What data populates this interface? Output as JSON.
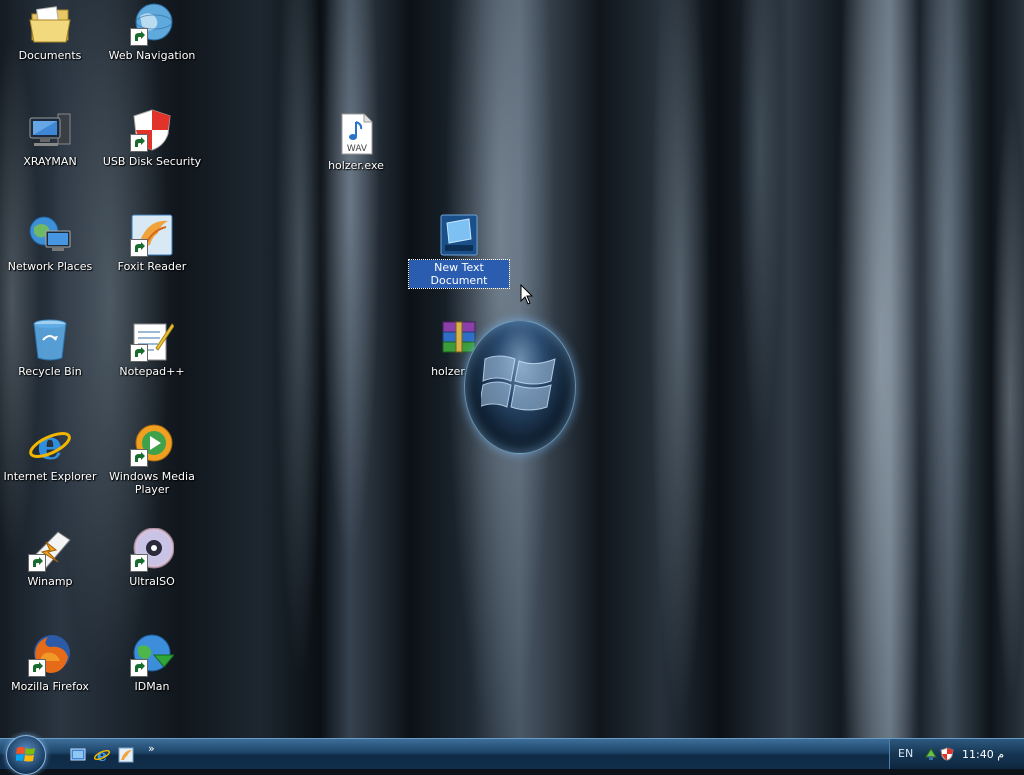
{
  "desktop": {
    "icons": [
      {
        "label": "Documents",
        "icon": "documents-folder-icon",
        "shortcut": false
      },
      {
        "label": "Web Navigation",
        "icon": "web-navigation-globe-icon",
        "shortcut": true
      },
      {
        "label": "XRAYMAN",
        "icon": "computer-icon",
        "shortcut": false
      },
      {
        "label": "USB Disk Security",
        "icon": "usb-disk-security-shield-icon",
        "shortcut": true
      },
      {
        "label": "holzer.exe",
        "icon": "wav-file-icon",
        "shortcut": false,
        "badge": "WAV"
      },
      {
        "label": "Network Places",
        "icon": "network-places-icon",
        "shortcut": false
      },
      {
        "label": "Foxit Reader",
        "icon": "foxit-reader-icon",
        "shortcut": true
      },
      {
        "label": "New Text Document",
        "icon": "text-document-icon",
        "shortcut": false,
        "selected": true
      },
      {
        "label": "Recycle Bin",
        "icon": "recycle-bin-icon",
        "shortcut": false
      },
      {
        "label": "Notepad++",
        "icon": "notepad-plus-plus-icon",
        "shortcut": true
      },
      {
        "label": "holzer.exe",
        "icon": "winrar-archive-icon",
        "shortcut": false
      },
      {
        "label": "Internet Explorer",
        "icon": "internet-explorer-icon",
        "shortcut": false
      },
      {
        "label": "Windows Media Player",
        "icon": "windows-media-player-icon",
        "shortcut": true
      },
      {
        "label": "Winamp",
        "icon": "winamp-icon",
        "shortcut": true
      },
      {
        "label": "UltraISO",
        "icon": "ultraiso-disc-icon",
        "shortcut": true
      },
      {
        "label": "Mozilla Firefox",
        "icon": "firefox-icon",
        "shortcut": true
      },
      {
        "label": "IDMan",
        "icon": "idman-globe-icon",
        "shortcut": true
      }
    ],
    "wallpaper_logo": "windows-logo-orb"
  },
  "taskbar": {
    "start_icon": "start-orb-icon",
    "quick_launch": [
      {
        "icon": "show-desktop-icon"
      },
      {
        "icon": "internet-explorer-icon"
      },
      {
        "icon": "foxit-reader-icon"
      }
    ],
    "more_chevron": "»",
    "tray": {
      "language": "EN",
      "icons": [
        "network-tray-icon",
        "usb-security-tray-icon"
      ],
      "clock": "11:40 م"
    }
  },
  "colors": {
    "taskbar": "#1d4569",
    "selection": "#2a5db0",
    "label_text": "#ffffff"
  }
}
